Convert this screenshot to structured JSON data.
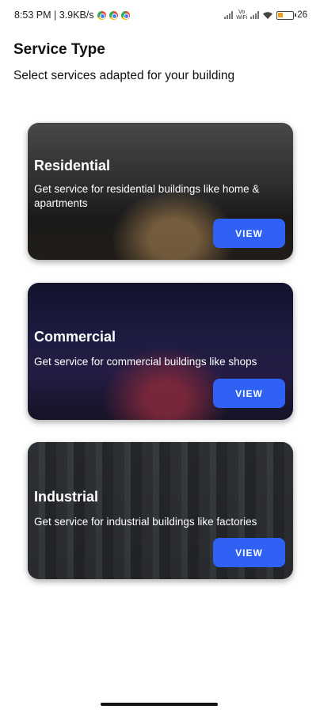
{
  "status_bar": {
    "time_speed": "8:53 PM | 3.9KB/s",
    "vowifi_top": "Vo",
    "vowifi_bottom": "WiFi",
    "battery": "26"
  },
  "header": {
    "title": "Service Type",
    "subtitle": "Select services adapted for your building"
  },
  "cards": [
    {
      "title": "Residential",
      "description": "Get service for residential buildings like home & apartments",
      "button_label": "VIEW"
    },
    {
      "title": "Commercial",
      "description": "Get service for commercial buildings like shops",
      "button_label": "VIEW"
    },
    {
      "title": "Industrial",
      "description": "Get service for industrial buildings like factories",
      "button_label": "VIEW"
    }
  ],
  "colors": {
    "accent": "#2f61f5"
  },
  "icons": [
    "chrome-icon",
    "signal-icon",
    "wifi-icon",
    "battery-icon"
  ]
}
